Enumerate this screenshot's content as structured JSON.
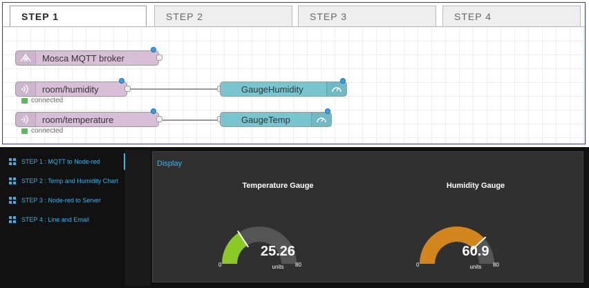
{
  "editor": {
    "tabs": [
      "STEP 1",
      "STEP 2",
      "STEP 3",
      "STEP 4"
    ],
    "active_tab": 0,
    "nodes": {
      "broker": "Mosca MQTT broker",
      "humidity_in": "room/humidity",
      "humidity_gauge": "GaugeHumidity",
      "temperature_in": "room/temperature",
      "temperature_gauge": "GaugeTemp"
    },
    "status": {
      "humidity": "connected",
      "temperature": "connected"
    }
  },
  "dashboard": {
    "nav": [
      "STEP 1 : MQTT to Node-red",
      "STEP 2 : Temp and Humidity Chart",
      "STEP 3 : Node-red to Server",
      "STEP 4 : Line and Email"
    ],
    "group_title": "Display",
    "temperature": {
      "title": "Temperature Gauge",
      "value": "25.26",
      "units": "units",
      "min": "0",
      "max": "80",
      "fraction": 0.316,
      "color": "#8ac926"
    },
    "humidity": {
      "title": "Humidity Gauge",
      "value": "60.9",
      "units": "units",
      "min": "0",
      "max": "80",
      "fraction": 0.761,
      "color": "#d4861e"
    },
    "track_color": "#555555"
  }
}
